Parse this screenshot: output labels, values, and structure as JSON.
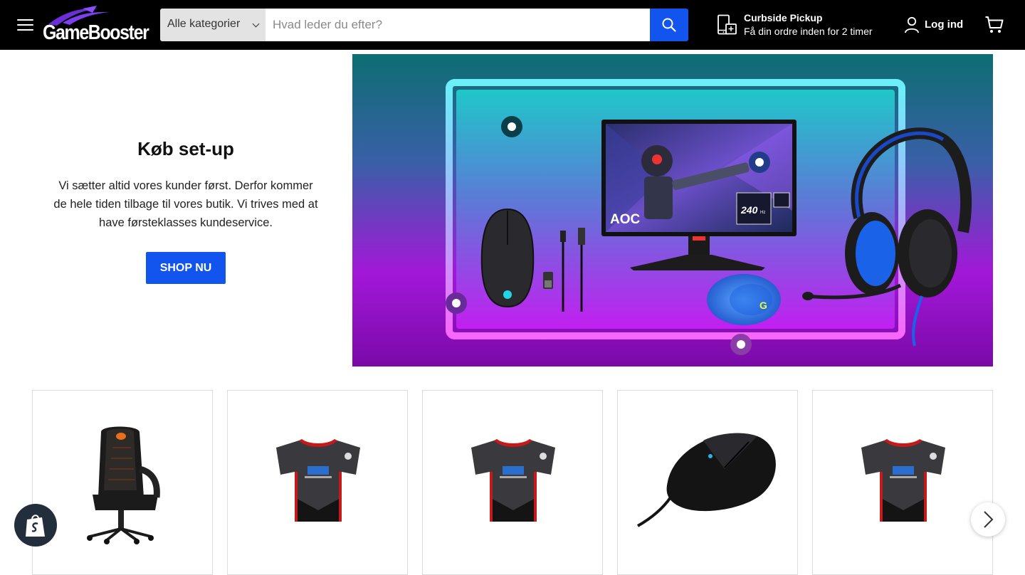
{
  "header": {
    "logo_text": "GameBooster",
    "category_select": "Alle kategorier",
    "search_placeholder": "Hvad leder du efter?",
    "pickup_title": "Curbside Pickup",
    "pickup_subtitle": "Få din ordre inden for 2 timer",
    "login_label": "Log ind"
  },
  "hero": {
    "title": "Køb set-up",
    "description": "Vi sætter altid vores kunder først. Derfor kommer de hele tiden tilbage til vores butik. Vi trives med at have førsteklasses kundeservice.",
    "cta_label": "SHOP NU",
    "monitor_brand": "AOC",
    "monitor_refresh": "240",
    "monitor_refresh_unit": "Hz"
  },
  "products": [
    {
      "image": "gaming-chair"
    },
    {
      "image": "jersey"
    },
    {
      "image": "jersey"
    },
    {
      "image": "gaming-mouse"
    },
    {
      "image": "jersey"
    }
  ],
  "icons": {
    "menu": "hamburger-icon",
    "search": "search-icon",
    "pickup": "store-pickup-icon",
    "user": "user-icon",
    "cart": "cart-icon",
    "next": "chevron-right-icon",
    "shopify": "shopify-bag-icon"
  },
  "colors": {
    "header_bg": "#000000",
    "accent_blue": "#1155ee",
    "logo_purple": "#6a2fd6"
  }
}
